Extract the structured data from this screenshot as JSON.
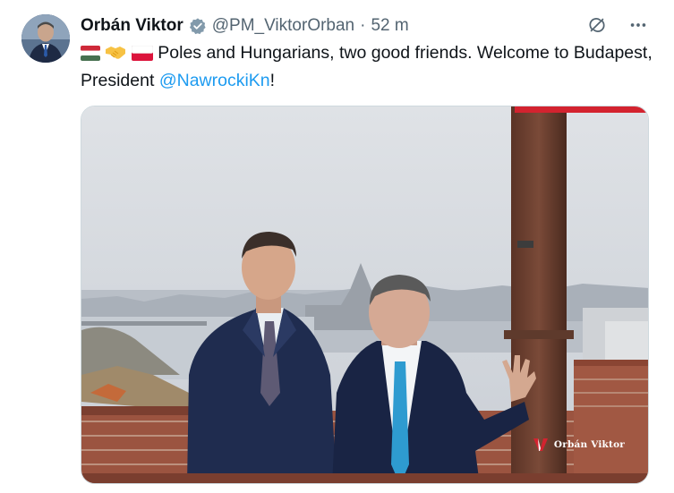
{
  "post": {
    "author_name": "Orbán Viktor",
    "handle": "@PM_ViktorOrban",
    "separator": "·",
    "time": "52 m",
    "text_before": "Poles and Hungarians, two good friends. Welcome to Budapest, President ",
    "mention": "@NawrockiKn",
    "text_after": "!",
    "emojis": [
      "hungary-flag",
      "handshake",
      "poland-flag"
    ]
  },
  "media": {
    "watermark": "Orbán Viktor",
    "accent_color": "#d3232f",
    "description_icons": [
      "photo"
    ]
  },
  "icons": [
    "verified-badge-icon",
    "grok-icon",
    "more-icon"
  ],
  "colors": {
    "text": "#0f1419",
    "secondary": "#536471",
    "link": "#1d9bf0",
    "verified": "#829aab"
  }
}
